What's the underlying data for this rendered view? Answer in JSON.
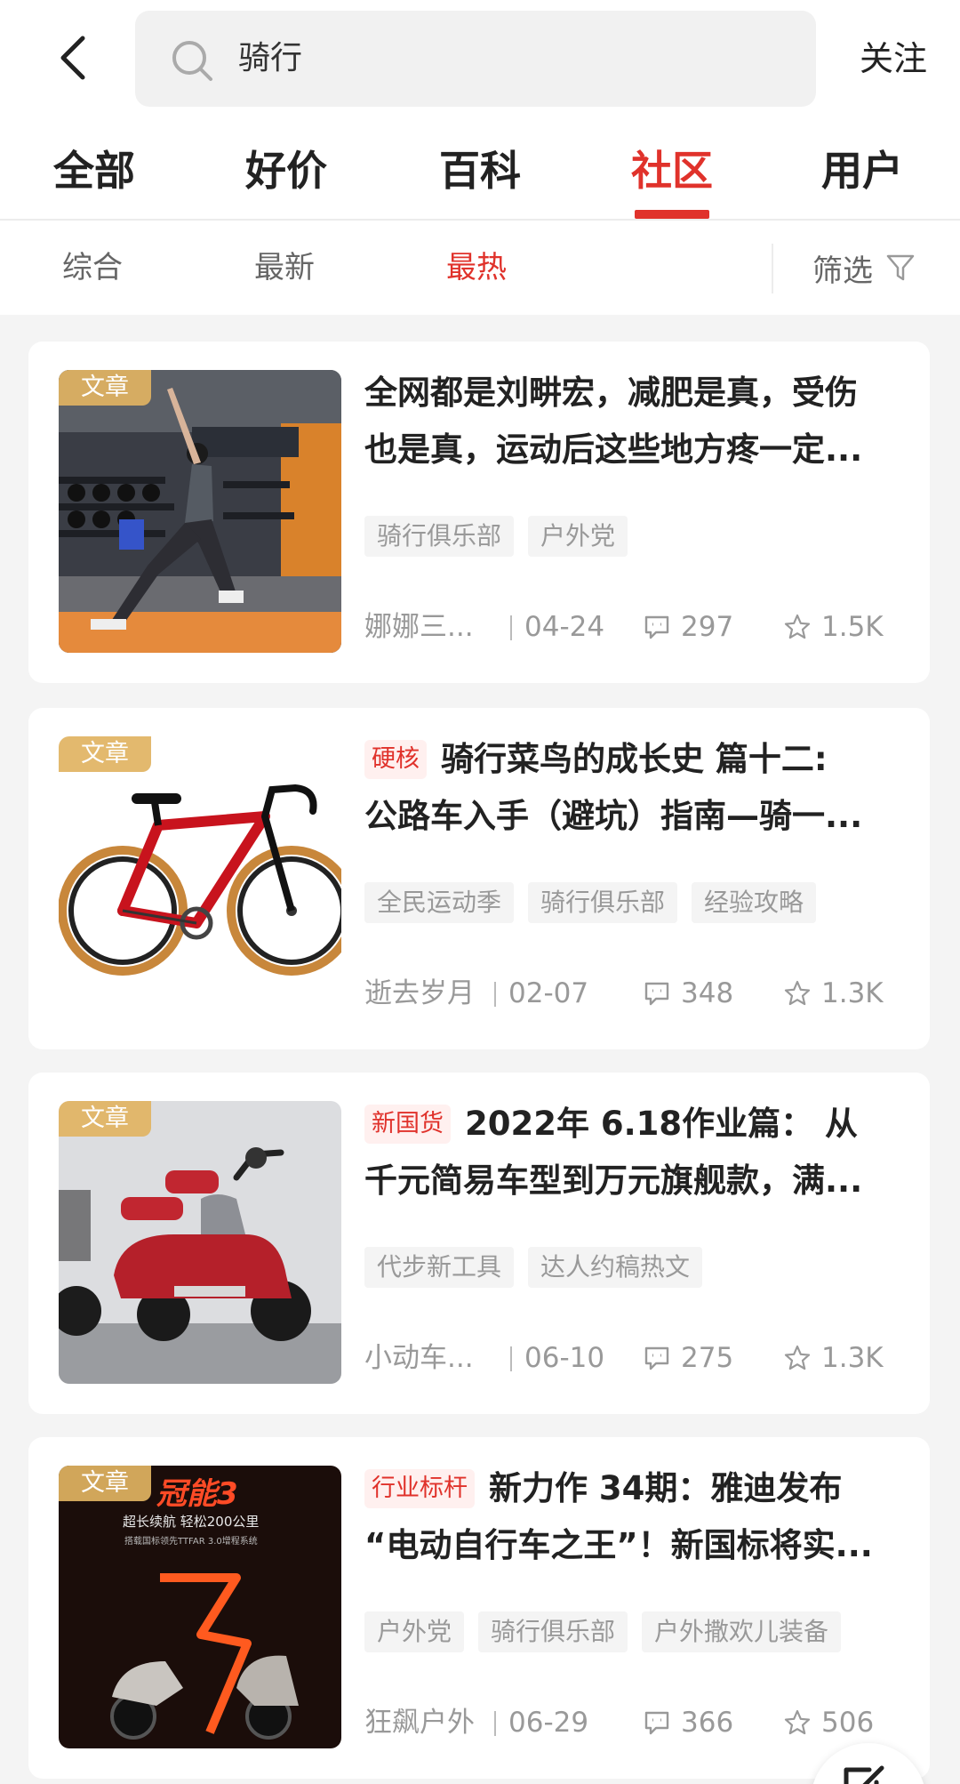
{
  "search": {
    "query": "骑行"
  },
  "header": {
    "follow_label": "关注"
  },
  "tabs": [
    {
      "label": "全部",
      "active": false
    },
    {
      "label": "好价",
      "active": false
    },
    {
      "label": "百科",
      "active": false
    },
    {
      "label": "社区",
      "active": true
    },
    {
      "label": "用户",
      "active": false
    }
  ],
  "subtabs": [
    {
      "label": "综合",
      "active": false
    },
    {
      "label": "最新",
      "active": false
    },
    {
      "label": "最热",
      "active": true
    }
  ],
  "filter": {
    "label": "筛选"
  },
  "accent_color": "#e0322b",
  "posts": [
    {
      "type": "文章",
      "title_tag": "",
      "title_line1": "全网都是刘畊宏，减肥是真，受伤",
      "title_line2": "也是真，运动后这些地方疼一定...",
      "tags": [
        "骑行俱乐部",
        "户外党"
      ],
      "author": "娜娜三...",
      "date": "04-24",
      "comments": "297",
      "stars": "1.5K"
    },
    {
      "type": "文章",
      "title_tag": "硬核",
      "title_line1": "骑行菜鸟的成长史 篇十二:",
      "title_line2": "公路车入手（避坑）指南—骑一...",
      "tags": [
        "全民运动季",
        "骑行俱乐部",
        "经验攻略"
      ],
      "author": "逝去岁月",
      "date": "02-07",
      "comments": "348",
      "stars": "1.3K"
    },
    {
      "type": "文章",
      "title_tag": "新国货",
      "title_line1": "2022年 6.18作业篇： 从",
      "title_line2": "千元简易车型到万元旗舰款，满...",
      "tags": [
        "代步新工具",
        "达人约稿热文"
      ],
      "author": "小动车...",
      "date": "06-10",
      "comments": "275",
      "stars": "1.3K"
    },
    {
      "type": "文章",
      "title_tag": "行业标杆",
      "title_line1": "新力作 34期：雅迪发布",
      "title_line2": "“电动自行车之王”！新国标将实...",
      "tags": [
        "户外党",
        "骑行俱乐部",
        "户外撒欢儿装备"
      ],
      "author": "狂飙户外",
      "date": "06-29",
      "comments": "366",
      "stars": "506",
      "thumb_text": {
        "brand": "冠能3",
        "slogan": "超长续航 轻松200公里",
        "fineprint": "搭载国标领先TTFAR 3.0增程系统"
      }
    }
  ]
}
